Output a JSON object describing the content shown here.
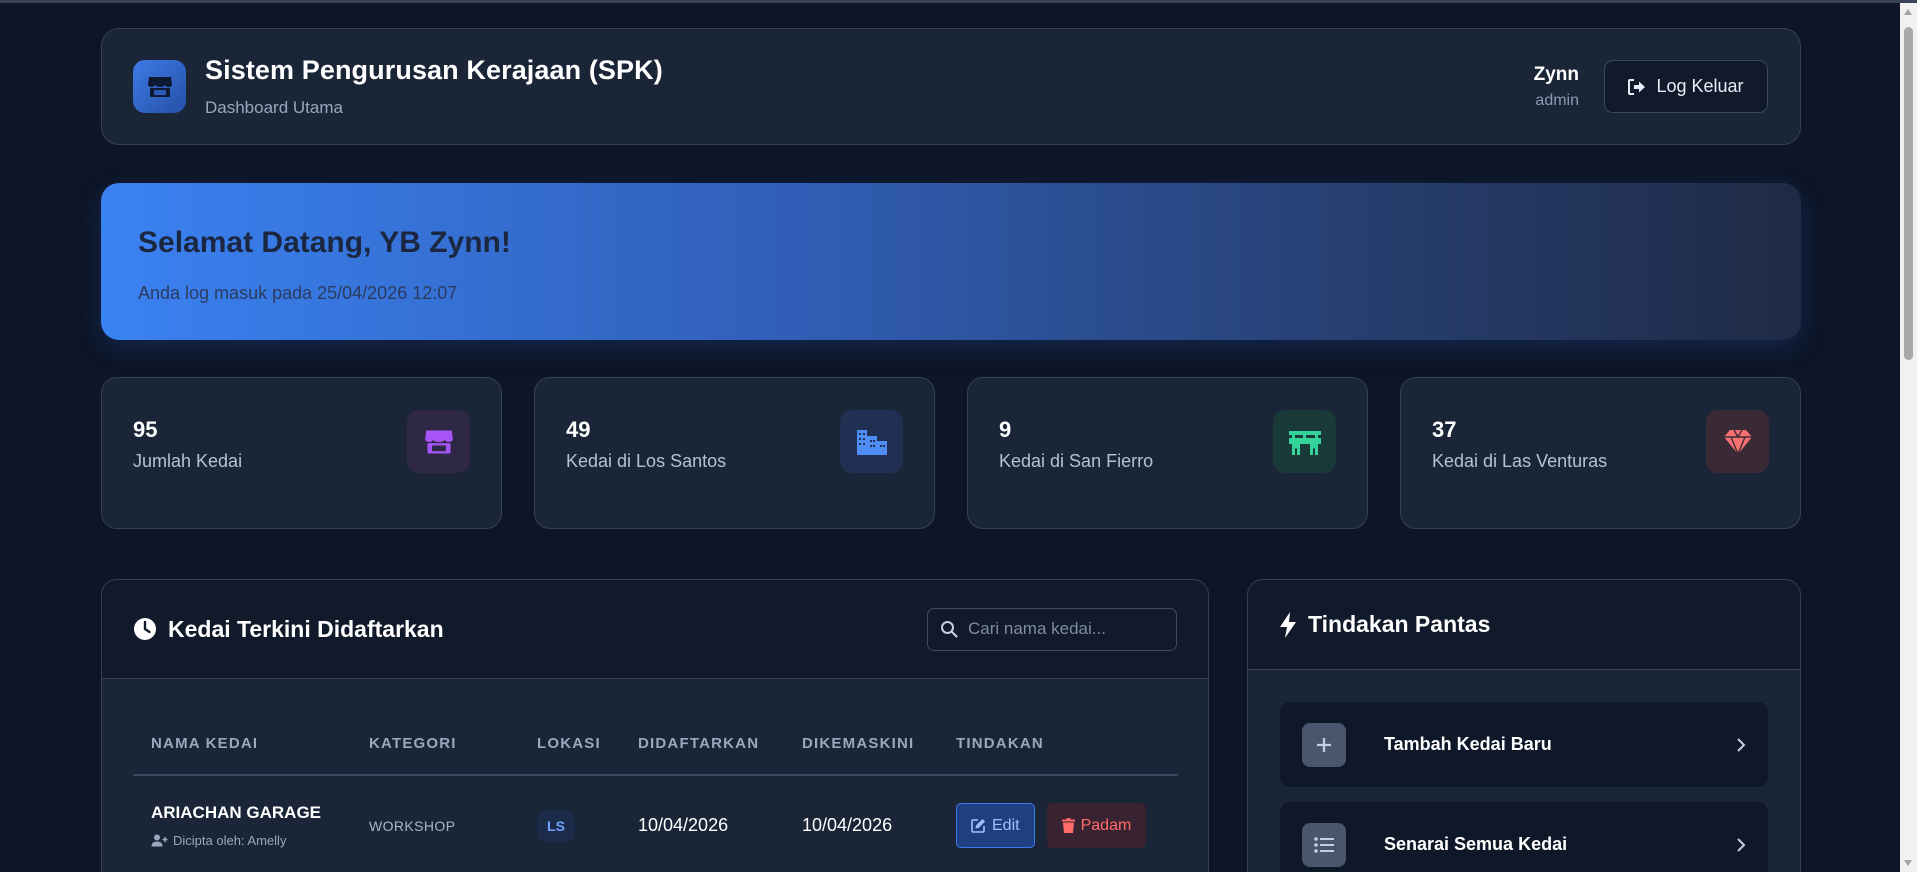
{
  "header": {
    "title": "Sistem Pengurusan Kerajaan (SPK)",
    "subtitle": "Dashboard Utama",
    "user_name": "Zynn",
    "user_role": "admin",
    "logout_label": "Log Keluar",
    "logo_icon": "store-icon"
  },
  "welcome": {
    "title": "Selamat Datang, YB Zynn!",
    "subtitle": "Anda log masuk pada 25/04/2026 12:07"
  },
  "stats": [
    {
      "value": "95",
      "label": "Jumlah Kedai",
      "icon": "store-icon",
      "color": "#a855f7",
      "bg": "#2e2746"
    },
    {
      "value": "49",
      "label": "Kedai di Los Santos",
      "icon": "city-icon",
      "color": "#4f8df5",
      "bg": "#1f3052"
    },
    {
      "value": "9",
      "label": "Kedai di San Fierro",
      "icon": "bridge-icon",
      "color": "#34d399",
      "bg": "#1a3a3a"
    },
    {
      "value": "37",
      "label": "Kedai di Las Venturas",
      "icon": "gem-icon",
      "color": "#f87171",
      "bg": "#3a2a36"
    }
  ],
  "recent": {
    "title": "Kedai Terkini Didaftarkan",
    "search_placeholder": "Cari nama kedai...",
    "columns": [
      "NAMA KEDAI",
      "KATEGORI",
      "LOKASI",
      "DIDAFTARKAN",
      "DIKEMASKINI",
      "TINDAKAN"
    ],
    "rows": [
      {
        "name": "ARIACHAN GARAGE",
        "creator": "Dicipta oleh: Amelly",
        "category": "WORKSHOP",
        "location": "LS",
        "registered": "10/04/2026",
        "updated": "10/04/2026",
        "edit_label": "Edit",
        "delete_label": "Padam"
      }
    ]
  },
  "quick_actions": {
    "title": "Tindakan Pantas",
    "items": [
      {
        "label": "Tambah Kedai Baru",
        "icon": "plus-icon"
      },
      {
        "label": "Senarai Semua Kedai",
        "icon": "list-icon"
      }
    ]
  },
  "colors": {
    "background": "#0d1526",
    "card": "#1a2537",
    "accent": "#3a82f2"
  }
}
